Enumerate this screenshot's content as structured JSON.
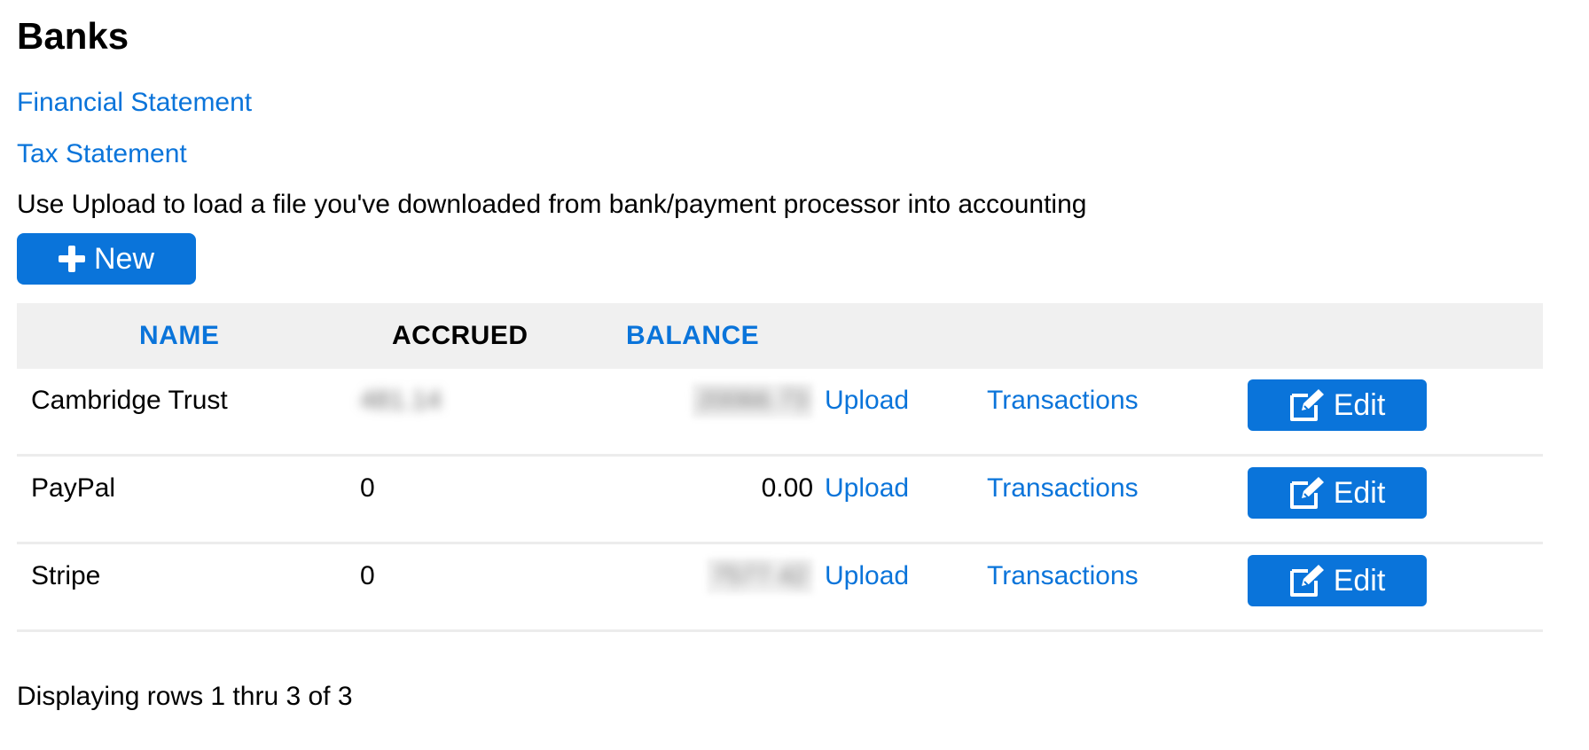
{
  "page": {
    "title": "Banks",
    "links": {
      "financial_statement": "Financial Statement",
      "tax_statement": "Tax Statement"
    },
    "helper_text": "Use Upload to load a file you've downloaded from bank/payment processor into accounting",
    "new_button": {
      "label": "New",
      "icon": "plus-icon"
    }
  },
  "table": {
    "columns": {
      "name": "NAME",
      "accrued": "ACCRUED",
      "balance": "BALANCE"
    },
    "rows": [
      {
        "name": "Cambridge Trust",
        "accrued": "481.14",
        "balance": "20066.73",
        "upload": "Upload",
        "transactions": "Transactions",
        "edit": "Edit",
        "accrued_redacted": true,
        "balance_redacted": true
      },
      {
        "name": "PayPal",
        "accrued": "0",
        "balance": "0.00",
        "upload": "Upload",
        "transactions": "Transactions",
        "edit": "Edit",
        "accrued_redacted": false,
        "balance_redacted": false
      },
      {
        "name": "Stripe",
        "accrued": "0",
        "balance": "7577.42",
        "upload": "Upload",
        "transactions": "Transactions",
        "edit": "Edit",
        "accrued_redacted": false,
        "balance_redacted": true
      }
    ]
  },
  "footer": {
    "text": "Displaying rows 1 thru 3 of 3"
  },
  "colors": {
    "accent": "#0a74da",
    "header_bg": "#f0f0f0",
    "row_divider": "#ececec"
  }
}
